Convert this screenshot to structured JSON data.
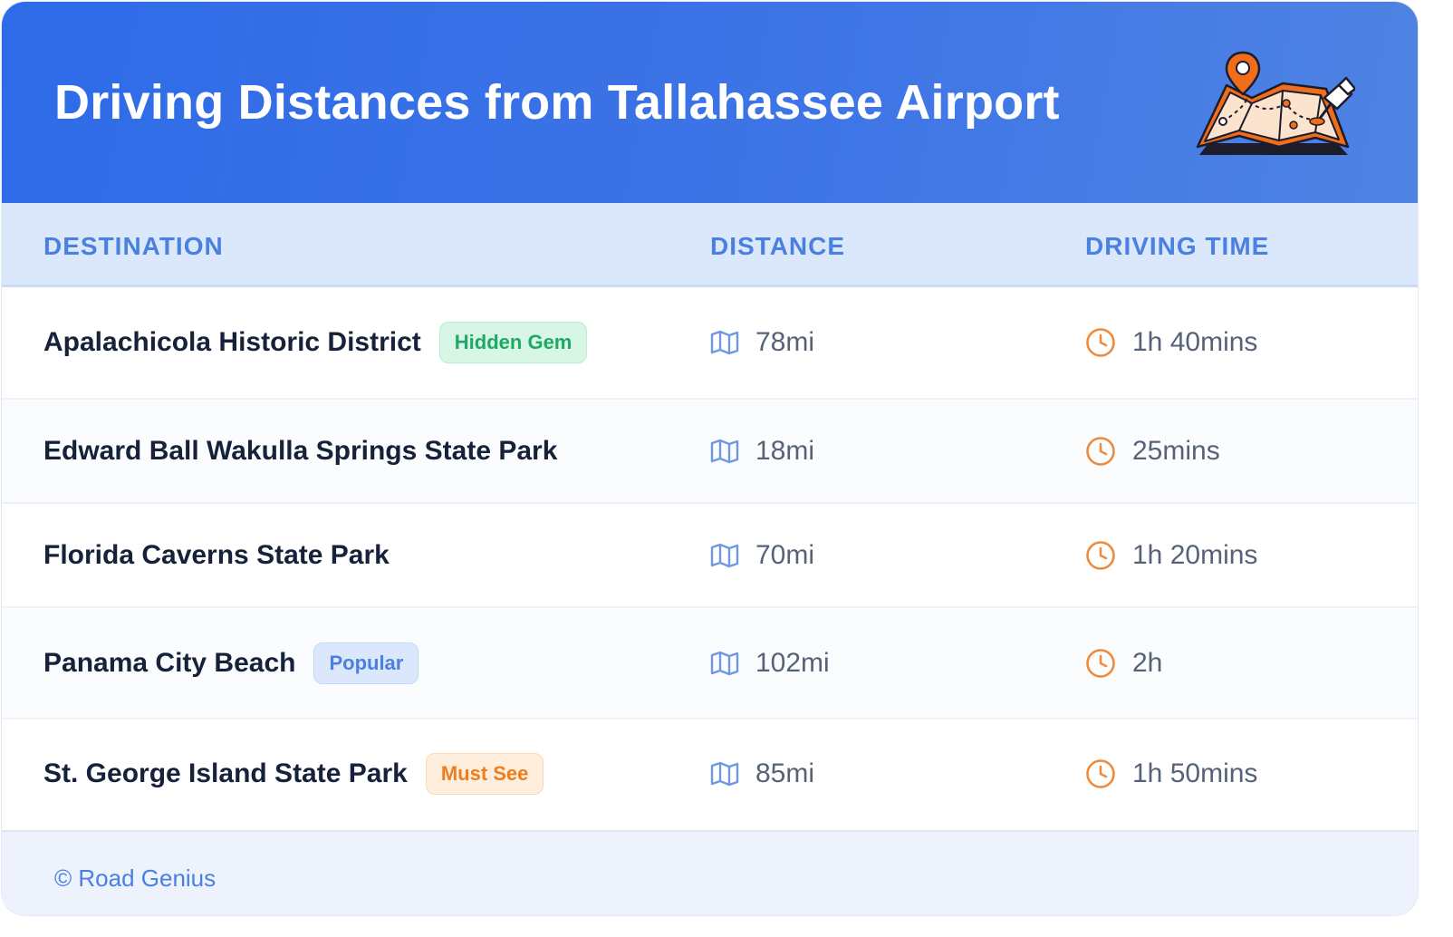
{
  "header": {
    "title": "Driving Distances from Tallahassee Airport",
    "illustration_icon": "folded-map-with-pins-icon"
  },
  "table": {
    "columns": [
      "DESTINATION",
      "DISTANCE",
      "DRIVING TIME"
    ],
    "rows": [
      {
        "destination": "Apalachicola Historic District",
        "badge": "Hidden Gem",
        "badge_color": "green",
        "distance": "78mi",
        "time": "1h 40mins"
      },
      {
        "destination": "Edward Ball Wakulla Springs State Park",
        "badge": "",
        "badge_color": "",
        "distance": "18mi",
        "time": "25mins"
      },
      {
        "destination": "Florida Caverns State Park",
        "badge": "",
        "badge_color": "",
        "distance": "70mi",
        "time": "1h 20mins"
      },
      {
        "destination": "Panama City Beach",
        "badge": "Popular",
        "badge_color": "blue",
        "distance": "102mi",
        "time": "2h"
      },
      {
        "destination": "St. George Island State Park",
        "badge": "Must See",
        "badge_color": "orange",
        "distance": "85mi",
        "time": "1h 50mins"
      }
    ]
  },
  "footer": {
    "copyright": "© Road Genius"
  },
  "colors": {
    "header_blue": "#2f6be8",
    "accent_blue": "#4a80df",
    "badge_green": "#1fa866",
    "badge_orange": "#ee7d1f",
    "clock_orange": "#ee8a3c"
  },
  "icons": {
    "distance": "map-icon",
    "time": "clock-icon"
  }
}
